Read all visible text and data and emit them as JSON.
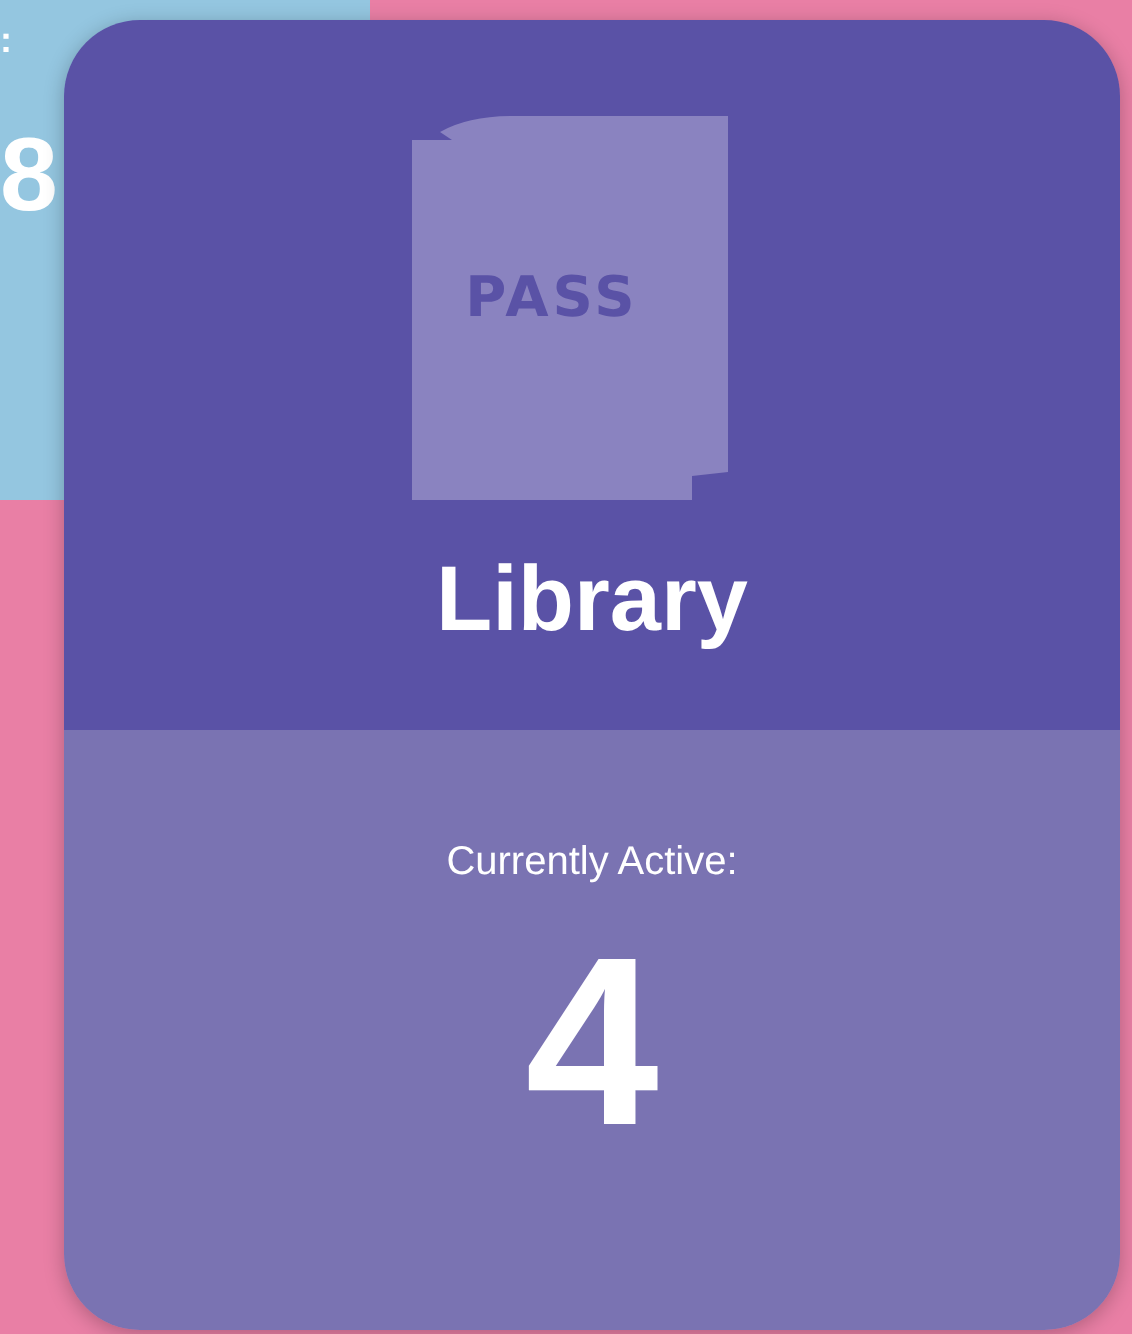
{
  "background_tile": {
    "label": ":",
    "count": "8"
  },
  "card": {
    "icon_label": "PASS",
    "title": "Library",
    "subtitle": "Currently Active:",
    "count": "4"
  }
}
